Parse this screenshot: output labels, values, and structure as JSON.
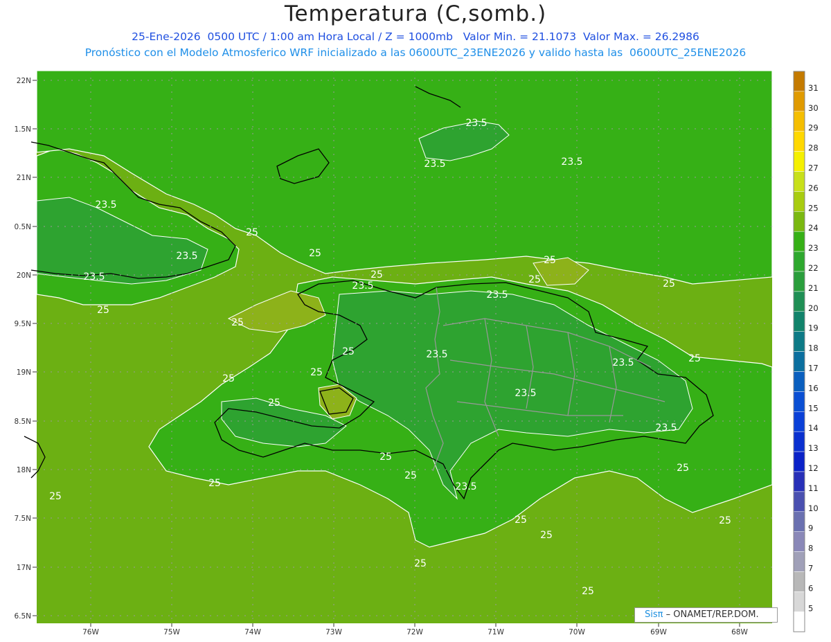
{
  "title": "Temperatura (C,somb.)",
  "subtitle_line1": "25-Ene-2026  0500 UTC / 1:00 am Hora Local / Z = 1000mb   Valor Min. = 21.1073  Valor Max. = 26.2986",
  "subtitle_line2": "Pronóstico con el Modelo Atmosferico WRF inicializado a las 0600UTC_23ENE2026 y valido hasta las  0600UTC_25ENE2026",
  "colors": {
    "green_main": "#36b016",
    "green_dark": "#2ea330",
    "green_light": "#6cb013",
    "green_olive": "#8db21a"
  },
  "lat_labels": [
    "22N",
    "1.5N",
    "21N",
    "0.5N",
    "20N",
    "9.5N",
    "19N",
    "8.5N",
    "18N",
    "7.5N",
    "17N",
    "6.5N"
  ],
  "lon_labels": [
    "76W",
    "75W",
    "74W",
    "73W",
    "72W",
    "71W",
    "70W",
    "69W",
    "68W"
  ],
  "contour_labels": [
    "23.5",
    "23.5",
    "23.5",
    "23.5",
    "23.5",
    "23.5",
    "23.5",
    "23.5",
    "23.5",
    "23.5",
    "23.5",
    "23.5",
    "23.5",
    "25",
    "25",
    "25",
    "25",
    "25",
    "25",
    "25",
    "25",
    "25",
    "25",
    "25",
    "25",
    "25",
    "25",
    "25",
    "25",
    "25",
    "25",
    "25",
    "25",
    "25",
    "25",
    "25"
  ],
  "colorbar": {
    "labels": [
      "31",
      "30",
      "29",
      "28",
      "27",
      "26",
      "25",
      "24",
      "23",
      "22",
      "21",
      "20",
      "19",
      "18",
      "17",
      "16",
      "15",
      "14",
      "13",
      "12",
      "11",
      "10",
      "9",
      "8",
      "7",
      "6",
      "5"
    ],
    "colors": [
      "#c47a00",
      "#e09a00",
      "#f5be00",
      "#ffd800",
      "#f5f000",
      "#c8e01a",
      "#a8cc10",
      "#7ab810",
      "#36b016",
      "#2ea82e",
      "#2a9e3c",
      "#1f8f55",
      "#12836b",
      "#0d7a86",
      "#0b6f9f",
      "#0a5fbf",
      "#0a4fd4",
      "#0a40d8",
      "#0a30d0",
      "#0a22c8",
      "#2830b8",
      "#4a50b0",
      "#6a70b0",
      "#8a88b8",
      "#a0a0b8",
      "#b8b8b8",
      "#d8d8d8",
      "#ffffff"
    ]
  },
  "credit": {
    "sis": "Sisπ",
    "org": " – ONAMET/REP.DOM."
  }
}
